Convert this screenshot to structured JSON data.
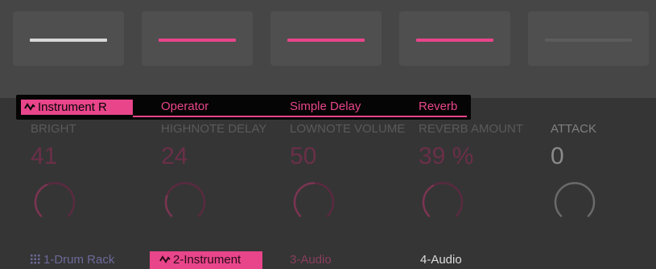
{
  "pads": [
    {
      "name": "pad-1",
      "color": "#d8d8d8"
    },
    {
      "name": "pad-2",
      "color": "#e8458a"
    },
    {
      "name": "pad-3",
      "color": "#e8458a"
    },
    {
      "name": "pad-4",
      "color": "#e8458a"
    },
    {
      "name": "pad-5",
      "color": "#5c5c5c"
    }
  ],
  "device_tabs": {
    "items": [
      {
        "label": "Instrument R",
        "icon": "rack-icon",
        "selected": true
      },
      {
        "label": "Operator",
        "selected": false
      },
      {
        "label": "Simple Delay",
        "selected": false
      },
      {
        "label": "Reverb",
        "selected": false
      }
    ]
  },
  "params": [
    {
      "name": "BRIGHT",
      "value": "41",
      "level": 0.41
    },
    {
      "name": "HIGHNOTE DELAY",
      "value": "24",
      "level": 0.24
    },
    {
      "name": "LOWNOTE VOLUME",
      "value": "50",
      "level": 0.5
    },
    {
      "name": "REVERB AMOUNT",
      "value": "39 %",
      "level": 0.39
    },
    {
      "name": "ATTACK",
      "value": "0",
      "level": 0.0
    }
  ],
  "tracks": [
    {
      "label": "1-Drum Rack",
      "icon": "grid-icon"
    },
    {
      "label": "2-Instrument",
      "icon": "rack-icon"
    },
    {
      "label": "3-Audio"
    },
    {
      "label": "4-Audio"
    }
  ],
  "colors": {
    "accent": "#e8458a",
    "knob_dim": "#7a3552"
  }
}
